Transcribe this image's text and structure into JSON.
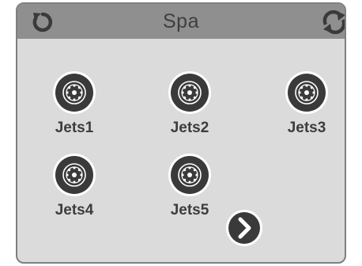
{
  "header": {
    "title": "Spa",
    "left_icon": "refresh-icon",
    "right_icon": "sync-icon"
  },
  "jets": [
    {
      "label": "Jets1",
      "icon": "jet-icon"
    },
    {
      "label": "Jets2",
      "icon": "jet-icon"
    },
    {
      "label": "Jets3",
      "icon": "jet-icon"
    },
    {
      "label": "Jets4",
      "icon": "jet-icon"
    },
    {
      "label": "Jets5",
      "icon": "jet-icon"
    }
  ],
  "navigation": {
    "next_icon": "chevron-right-icon"
  },
  "colors": {
    "header_bg": "#8f8f8f",
    "panel_bg": "#dbdbdc",
    "icon_dark": "#3a3a3a"
  }
}
